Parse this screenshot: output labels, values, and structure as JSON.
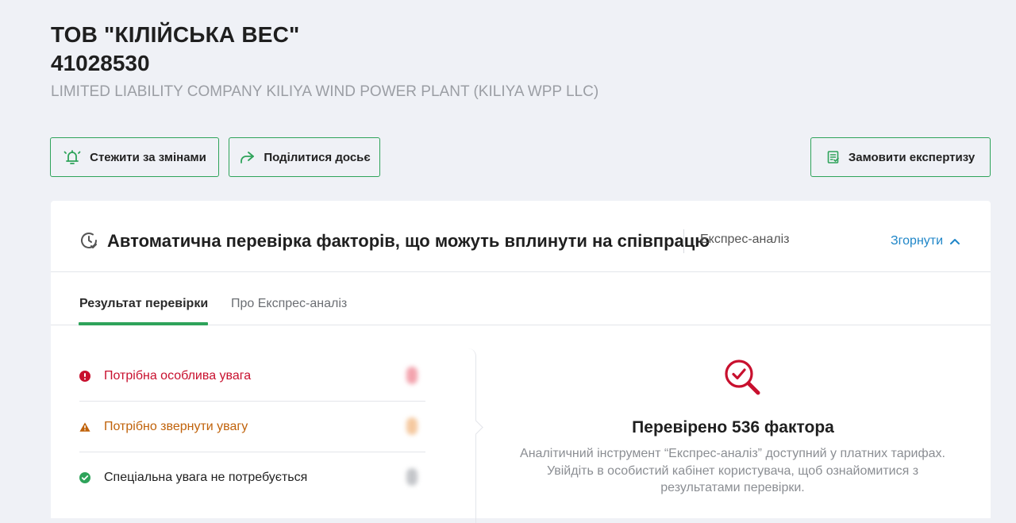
{
  "company": {
    "name": "ТОВ \"КІЛІЙСЬКА ВЕС\"",
    "code": "41028530",
    "name_en": "LIMITED LIABILITY COMPANY KILIYA WIND POWER PLANT (KILIYA WPP LLC)"
  },
  "actions": {
    "watch_label": "Стежити за змінами",
    "share_label": "Поділитися досьє",
    "order_label": "Замовити експертизу"
  },
  "check": {
    "title": "Автоматична перевірка факторів, що можуть вплинути на співпрацю",
    "mode_label": "Експрес-аналіз",
    "collapse_label": "Згорнути"
  },
  "tabs": [
    {
      "label": "Результат перевірки",
      "active": true
    },
    {
      "label": "Про Експрес-аналіз",
      "active": false
    }
  ],
  "results": [
    {
      "label": "Потрібна особлива увага",
      "status": "critical",
      "color": "#c8102e"
    },
    {
      "label": "Потрібно звернути увагу",
      "status": "warning",
      "color": "#c0620a"
    },
    {
      "label": "Спеціальна увага не потребується",
      "status": "ok",
      "color": "#2ea35a"
    }
  ],
  "info": {
    "title": "Перевірено 536 фактора",
    "text": "Аналітичний інструмент “Експрес-аналіз” доступний у платних тарифах. Увійдіть в особистий кабінет користувача, щоб ознайомитися з результатами перевірки."
  },
  "colors": {
    "accent_green": "#2ea35a",
    "link_blue": "#1f86c8",
    "critical_red": "#c8102e",
    "background": "#eff1f6"
  },
  "icons": {
    "watch": "bell-icon",
    "share": "share-arrow-icon",
    "order": "document-list-icon",
    "check": "clock-check-icon",
    "collapse": "chevron-up-icon",
    "info": "magnifier-check-icon"
  }
}
